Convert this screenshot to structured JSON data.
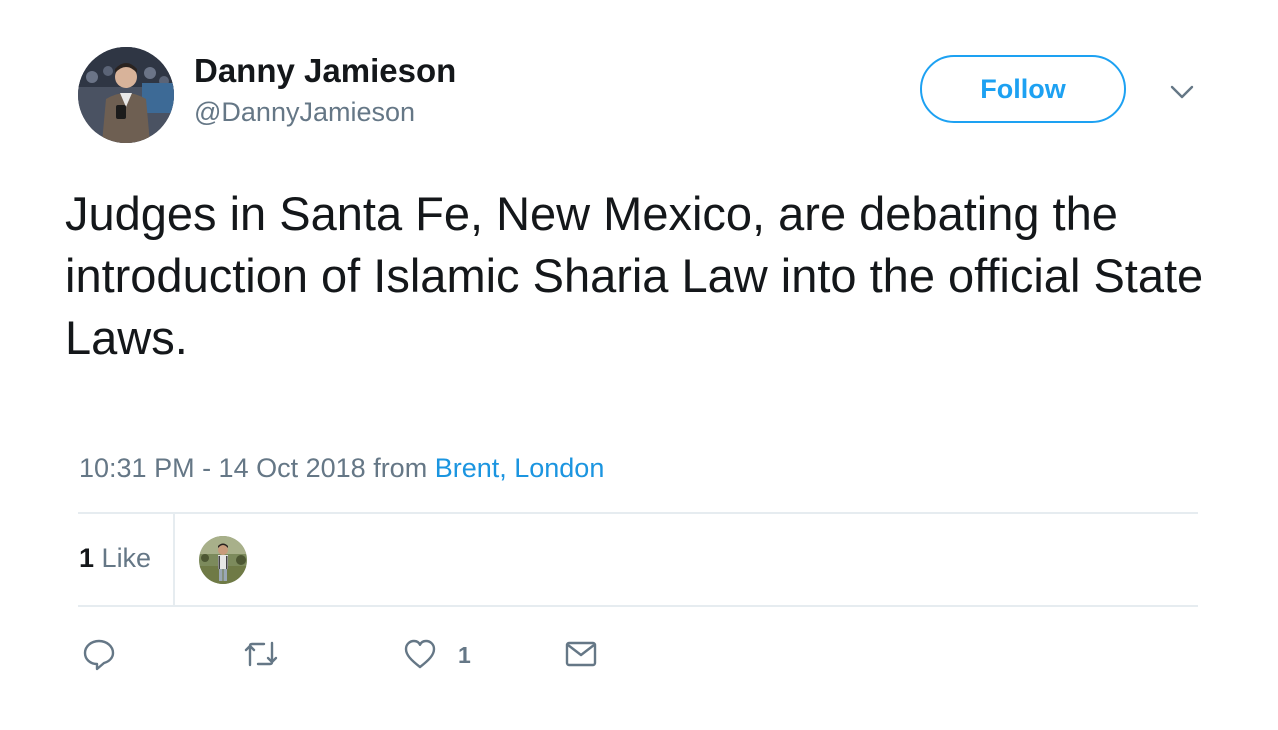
{
  "author": {
    "display_name": "Danny Jamieson",
    "handle": "@DannyJamieson"
  },
  "follow_label": "Follow",
  "tweet": {
    "text": "Judges in Santa Fe, New Mexico, are debating the introduction of Islamic Sharia Law into the official State Laws."
  },
  "meta": {
    "timestamp": "10:31 PM - 14 Oct 2018",
    "from": "from",
    "location": "Brent, London"
  },
  "stats": {
    "like_count": "1",
    "like_label": "Like"
  },
  "actions": {
    "like_count": "1"
  },
  "icons": {
    "reply": "reply-icon",
    "retweet": "retweet-icon",
    "like": "heart-icon",
    "dm": "envelope-icon",
    "more": "chevron-down-icon"
  },
  "colors": {
    "accent": "#1da1f2",
    "link": "#1b95e0",
    "text": "#14171a",
    "muted": "#657786",
    "divider": "#e6ecf0"
  }
}
